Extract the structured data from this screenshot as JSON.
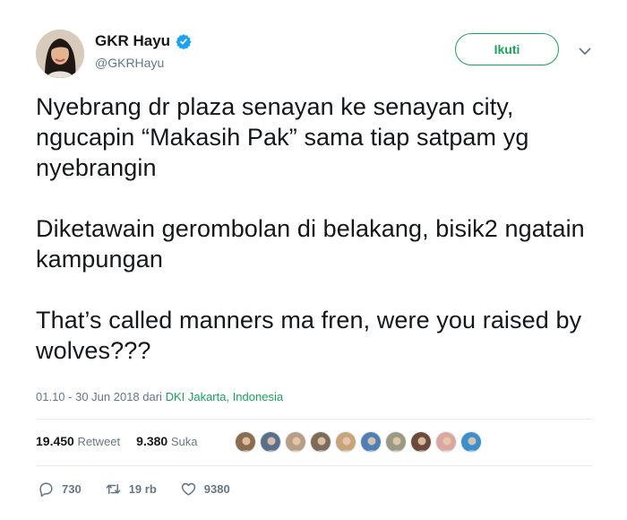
{
  "author": {
    "display_name": "GKR Hayu",
    "handle": "@GKRHayu"
  },
  "follow_label": "Ikuti",
  "tweet": {
    "paragraphs": [
      "Nyebrang dr plaza senayan ke senayan city, ngucapin “Makasih Pak” sama tiap satpam yg nyebrangin",
      "Diketawain gerombolan di belakang, bisik2 ngatain kampungan",
      "That’s called manners ma fren, were you raised by wolves???"
    ],
    "timestamp": "01.10 - 30 Jun 2018 dari ",
    "location": "DKI Jakarta, Indonesia"
  },
  "stats": {
    "retweets_count": "19.450",
    "retweets_label": "Retweet",
    "likes_count": "9.380",
    "likes_label": "Suka"
  },
  "liker_avatar_colors": [
    "#8a6d4f",
    "#5b6e8a",
    "#b79e86",
    "#7e6a58",
    "#c7a47a",
    "#4f7fb3",
    "#9a9a82",
    "#6b4a3a",
    "#d9a8a0",
    "#3d8ec9"
  ],
  "actions": {
    "reply_count": "730",
    "retweet_count": "19 rb",
    "like_count": "9380"
  },
  "colors": {
    "accent_green": "#1da15b",
    "verified_blue": "#1da1f2",
    "muted": "#657786"
  }
}
